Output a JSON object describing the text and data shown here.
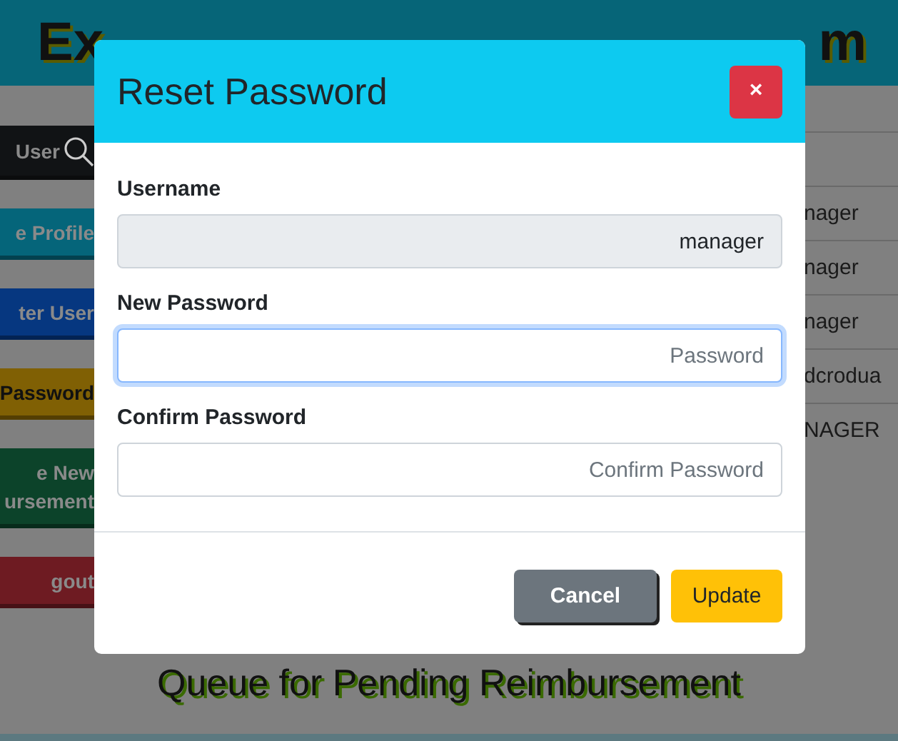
{
  "header": {
    "title_left": "Ex",
    "title_right": "m"
  },
  "sidebar": {
    "items": [
      {
        "label": "User",
        "color": "#111315",
        "kind": "search"
      },
      {
        "label": "e Profile",
        "color": "#05657a",
        "kind": "plain"
      },
      {
        "label": "ter User",
        "color": "#063780",
        "kind": "plain"
      },
      {
        "label": "Password",
        "color": "#806004",
        "kind": "plain"
      },
      {
        "label": "e New\nursement",
        "color": "#0c432a",
        "kind": "plain"
      },
      {
        "label": "gout",
        "color": "#6e1b22",
        "kind": "plain"
      }
    ]
  },
  "table": {
    "rows": [
      "nager",
      "nager",
      "nager",
      "dcrodua",
      "NAGER"
    ]
  },
  "section_title": "Queue for Pending Reimbursement",
  "modal": {
    "title": "Reset Password",
    "close": "×",
    "fields": [
      {
        "label": "Username",
        "value": "manager",
        "disabled": true,
        "focused": false
      },
      {
        "label": "New Password",
        "placeholder": "Password",
        "disabled": false,
        "focused": true
      },
      {
        "label": "Confirm Password",
        "placeholder": "Confirm Password",
        "disabled": false,
        "focused": false
      }
    ],
    "buttons": [
      {
        "label": "Cancel",
        "kind": "secondary"
      },
      {
        "label": "Update",
        "kind": "warning"
      }
    ]
  }
}
